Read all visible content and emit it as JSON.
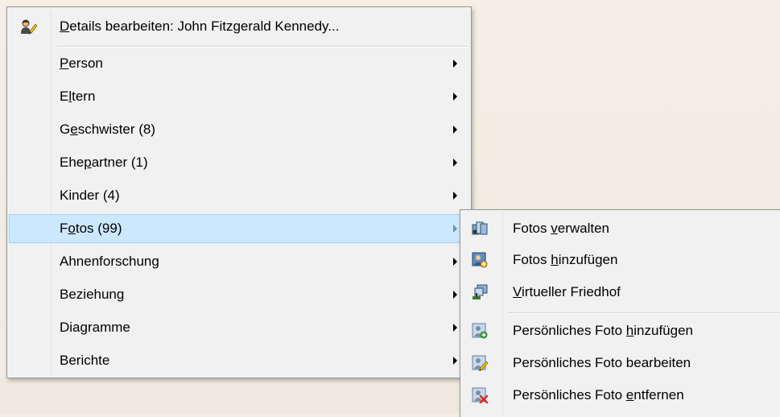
{
  "main_menu": {
    "header_item": {
      "icon": "edit-person-icon",
      "label_before": "",
      "label_mnemonic": "D",
      "label_after": "etails bearbeiten: John Fitzgerald Kennedy..."
    },
    "items": [
      {
        "before": "",
        "mnemonic": "P",
        "after": "erson",
        "has_submenu": true
      },
      {
        "before": "E",
        "mnemonic": "l",
        "after": "tern",
        "has_submenu": true
      },
      {
        "before": "G",
        "mnemonic": "e",
        "after": "schwister (8)",
        "has_submenu": true
      },
      {
        "before": "Ehe",
        "mnemonic": "p",
        "after": "artner (1)",
        "has_submenu": true
      },
      {
        "before": "Kinder (4)",
        "mnemonic": "",
        "after": "",
        "has_submenu": true
      },
      {
        "before": "F",
        "mnemonic": "o",
        "after": "tos (99)",
        "has_submenu": true,
        "highlighted": true
      },
      {
        "before": "Ahnenforschung",
        "mnemonic": "",
        "after": "",
        "has_submenu": true
      },
      {
        "before": "Beziehung",
        "mnemonic": "",
        "after": "",
        "has_submenu": true
      },
      {
        "before": "Diagramme",
        "mnemonic": "",
        "after": "",
        "has_submenu": true
      },
      {
        "before": "Berichte",
        "mnemonic": "",
        "after": "",
        "has_submenu": true
      }
    ]
  },
  "sub_menu": {
    "items": [
      {
        "icon": "photos-manage-icon",
        "before": "Fotos ",
        "mnemonic": "v",
        "after": "erwalten"
      },
      {
        "icon": "photo-add-icon",
        "before": "Fotos ",
        "mnemonic": "h",
        "after": "inzufügen"
      },
      {
        "icon": "virtual-cemetery-icon",
        "before": "",
        "mnemonic": "V",
        "after": "irtueller Friedhof"
      },
      {
        "icon": "personal-photo-add-icon",
        "before": "Persönliches Foto ",
        "mnemonic": "h",
        "after": "inzufügen"
      },
      {
        "icon": "personal-photo-edit-icon",
        "before": "Persönliches Foto bearbeiten",
        "mnemonic": "",
        "after": ""
      },
      {
        "icon": "personal-photo-remove-icon",
        "before": "Persönliches Foto ",
        "mnemonic": "e",
        "after": "ntfernen"
      }
    ]
  },
  "colors": {
    "menu_bg": "#f1f1f1",
    "highlight_bg": "#cce8ff",
    "highlight_border": "#99d1ff",
    "menu_border": "#979797"
  }
}
